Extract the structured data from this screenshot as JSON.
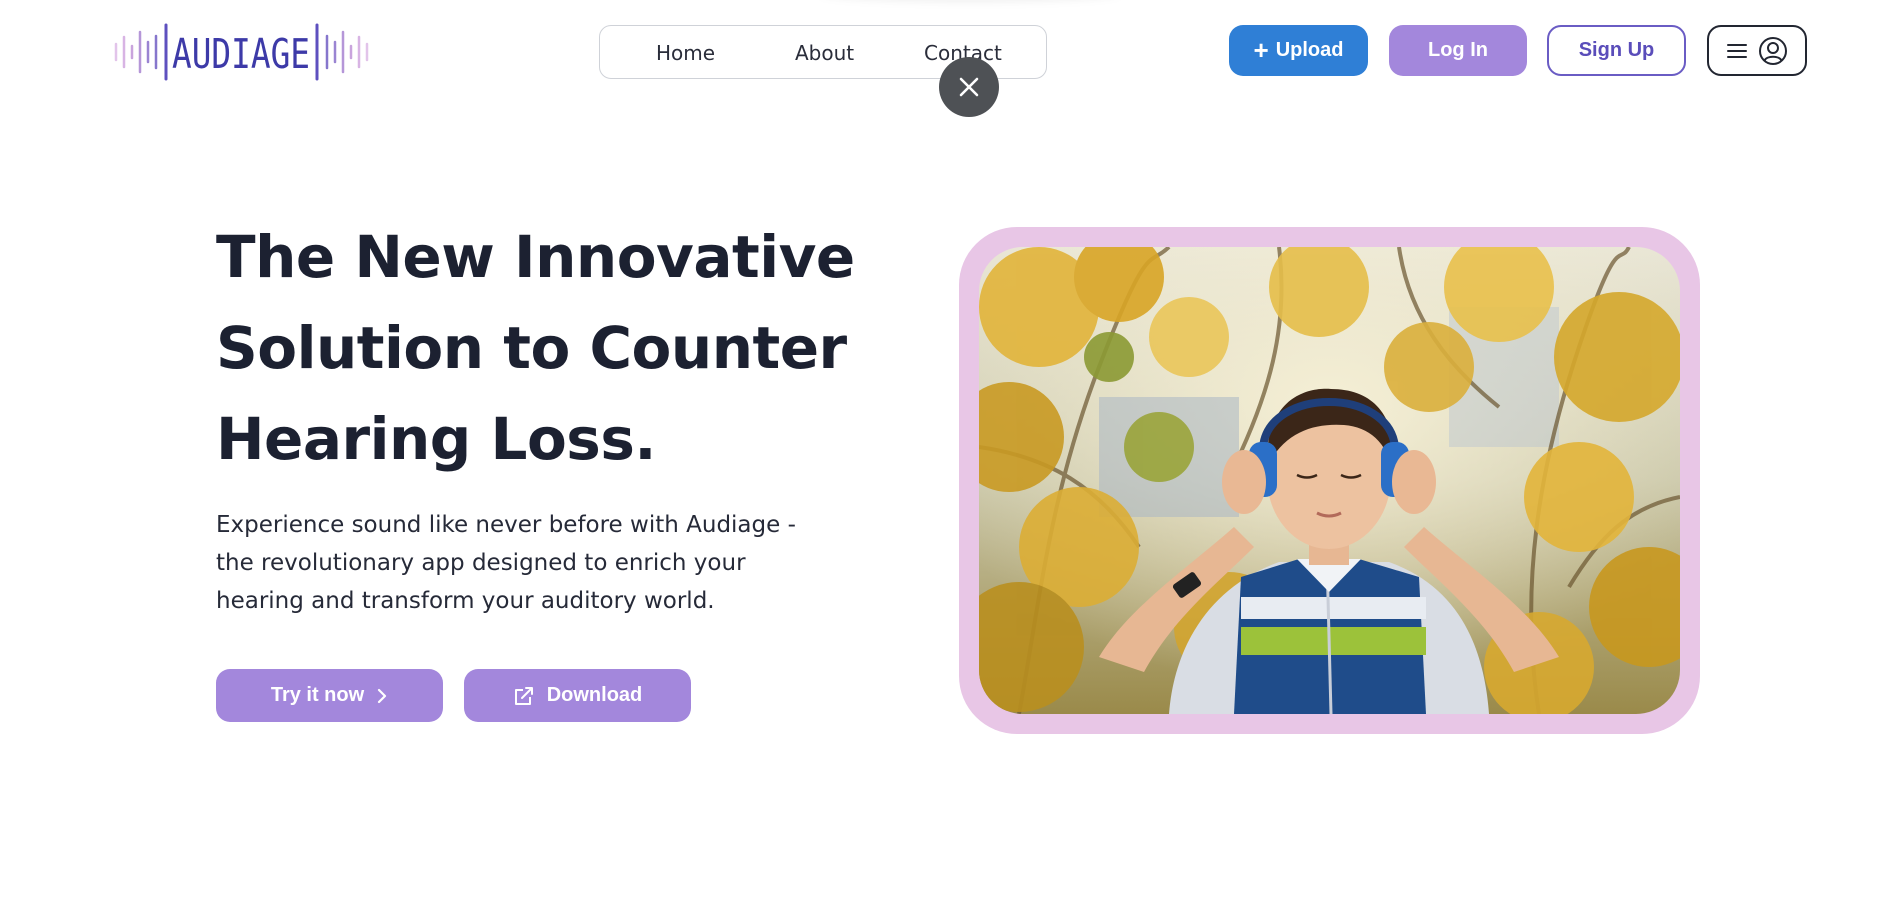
{
  "brand": {
    "logo_text": "AUDIAGE",
    "logo_colors": {
      "text": "#3d3aa8",
      "bars_light": "#cfa9de",
      "bars_dark": "#6b5bc3"
    }
  },
  "nav": {
    "items": [
      {
        "label": "Home"
      },
      {
        "label": "About"
      },
      {
        "label": "Contact"
      }
    ]
  },
  "overlay": {
    "close_icon": "close-icon"
  },
  "header_actions": {
    "upload_label": "Upload",
    "upload_icon": "plus-icon",
    "login_label": "Log In",
    "signup_label": "Sign Up",
    "menu_icons": [
      "hamburger-icon",
      "user-icon"
    ]
  },
  "hero": {
    "title_lines": [
      "The New Innovative",
      "Solution to Counter",
      "Hearing Loss."
    ],
    "subtitle_lines": [
      "Experience sound like never before with Audiage -",
      "the revolutionary app designed to enrich your",
      "hearing and transform your auditory world."
    ],
    "primary_cta": "Try it now",
    "secondary_cta": "Download"
  },
  "colors": {
    "primary_blue": "#2f7fd6",
    "purple": "#a387dc",
    "frame_pink": "#e8c6e6",
    "text_dark": "#1c2131"
  }
}
